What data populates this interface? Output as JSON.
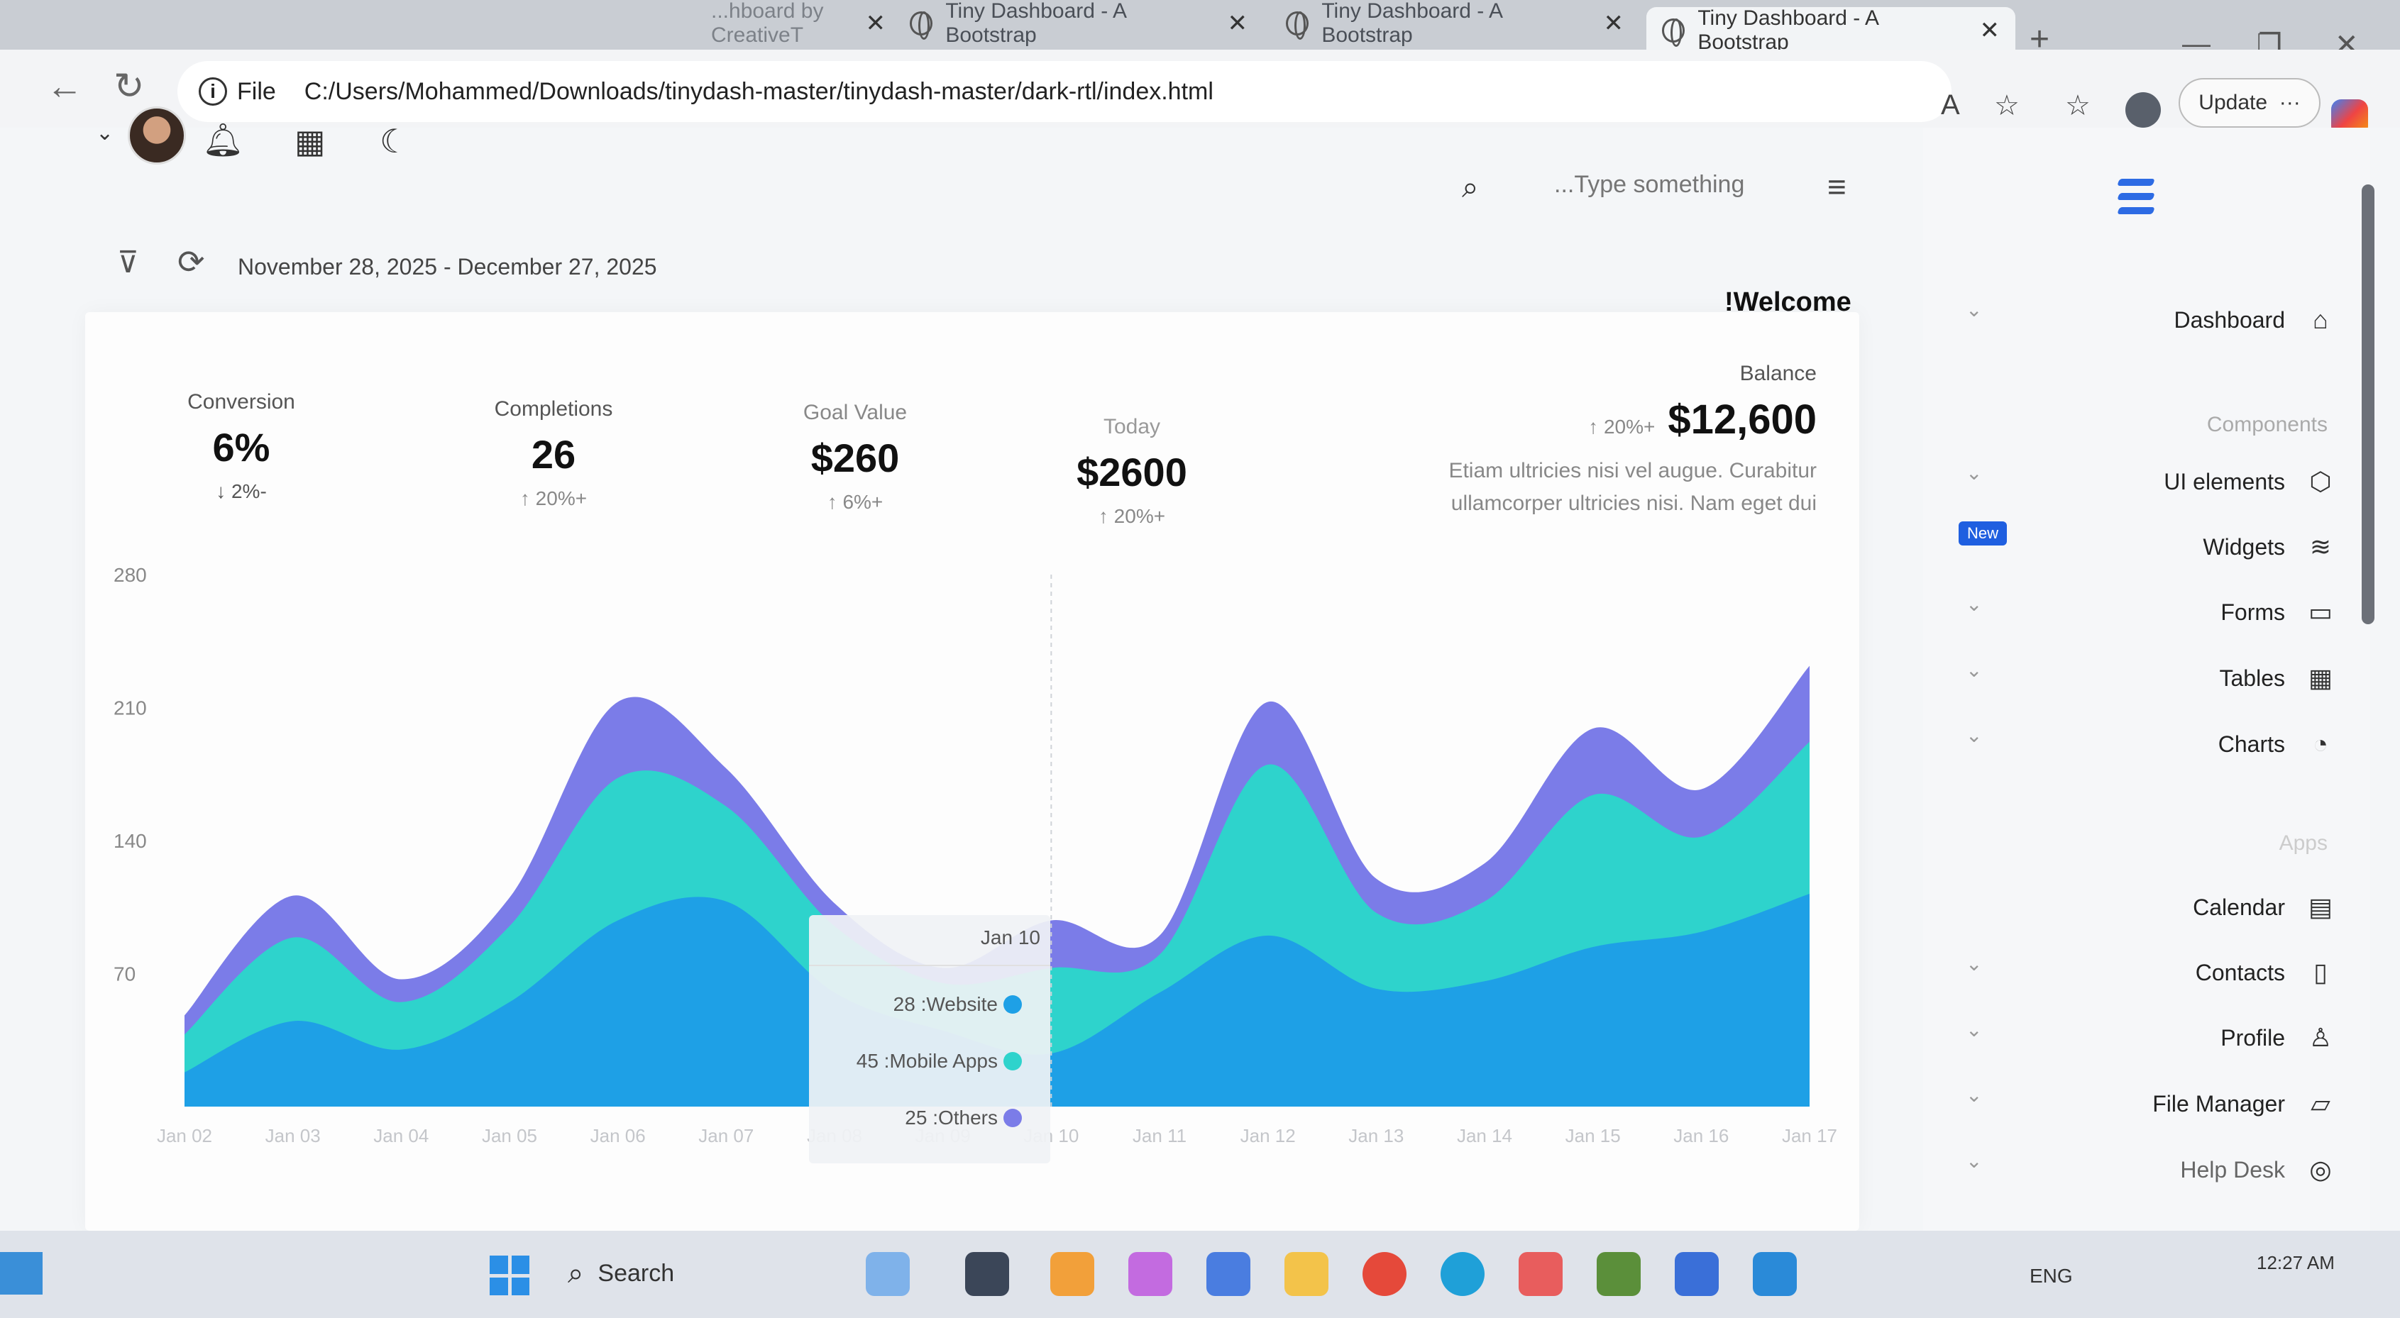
{
  "browser": {
    "tabs": [
      {
        "title": "Tiny Dashboard - A Bootstrap"
      },
      {
        "title": "Tiny Dashboard - A Bootstrap"
      },
      {
        "title": "Tiny Dashboard - A Bootstrap"
      }
    ],
    "partial_tab_title": "...hboard by CreativeT",
    "file_label": "File",
    "url": "C:/Users/Mohammed/Downloads/tinydash-master/tinydash-master/dark-rtl/index.html",
    "update_label": "Update"
  },
  "topnav": {
    "search_placeholder": "...Type something"
  },
  "filter": {
    "date_range": "November 28, 2025 - December 27, 2025"
  },
  "welcome": "!Welcome",
  "stats": [
    {
      "label": "Conversion",
      "value": "6%",
      "change": "↓ 2%-"
    },
    {
      "label": "Completions",
      "value": "26",
      "change": "↑ 20%+"
    },
    {
      "label": "Goal Value",
      "value": "$260",
      "change": "↑ 6%+"
    },
    {
      "label": "Today",
      "value": "$2600",
      "change": "↑ 20%+"
    }
  ],
  "balance": {
    "label": "Balance",
    "change": "↑ 20%+",
    "value": "$12,600",
    "description": "Etiam ultricies nisi vel augue. Curabitur ullamcorper ultricies nisi. Nam eget dui"
  },
  "chart_data": {
    "type": "area",
    "stacked": true,
    "x": [
      "Jan 02",
      "Jan 03",
      "Jan 04",
      "Jan 05",
      "Jan 06",
      "Jan 07",
      "Jan 08",
      "Jan 09",
      "Jan 10",
      "Jan 11",
      "Jan 12",
      "Jan 13",
      "Jan 14",
      "Jan 15",
      "Jan 16",
      "Jan 17"
    ],
    "yticks": [
      70,
      140,
      210,
      280
    ],
    "xtick_labels": [
      "Jan 02",
      "Jan 03",
      "Jan 04",
      "Jan 05",
      "Jan 06",
      "Jan 07",
      "Jan 08",
      "Jan 09",
      "Jan 10",
      "Jan 11",
      "Jan 12",
      "Jan 13",
      "Jan 14",
      "Jan 15",
      "Jan 16",
      "Jan 17"
    ],
    "ylim": [
      0,
      280
    ],
    "series": [
      {
        "name": "Website",
        "color": "#1ea0e6",
        "values": [
          18,
          45,
          30,
          55,
          98,
          108,
          60,
          40,
          28,
          60,
          90,
          62,
          66,
          84,
          92,
          112
        ]
      },
      {
        "name": "Mobile Apps",
        "color": "#2ed3cc",
        "values": [
          20,
          44,
          25,
          40,
          75,
          50,
          35,
          25,
          45,
          20,
          90,
          40,
          42,
          80,
          50,
          80
        ]
      },
      {
        "name": "Others",
        "color": "#7b7ce8",
        "values": [
          10,
          22,
          12,
          15,
          40,
          20,
          12,
          8,
          25,
          10,
          33,
          18,
          20,
          35,
          25,
          40
        ]
      }
    ]
  },
  "tooltip": {
    "title": "Jan 10",
    "rows": [
      {
        "text": "28 :Website",
        "color": "#1ea0e6"
      },
      {
        "text": "45 :Mobile Apps",
        "color": "#2ed3cc"
      },
      {
        "text": "25 :Others",
        "color": "#7b7ce8"
      }
    ]
  },
  "sidebar": {
    "dashboard": "Dashboard",
    "components_title": "Components",
    "ui_elements": "UI elements",
    "widgets": "Widgets",
    "new_badge": "New",
    "forms": "Forms",
    "tables": "Tables",
    "charts": "Charts",
    "apps_title": "Apps",
    "calendar": "Calendar",
    "contacts": "Contacts",
    "profile": "Profile",
    "file_manager": "File Manager",
    "help_desk": "Help Desk"
  },
  "taskbar": {
    "search_label": "Search",
    "lang": "ENG",
    "time": "12:27 AM"
  }
}
